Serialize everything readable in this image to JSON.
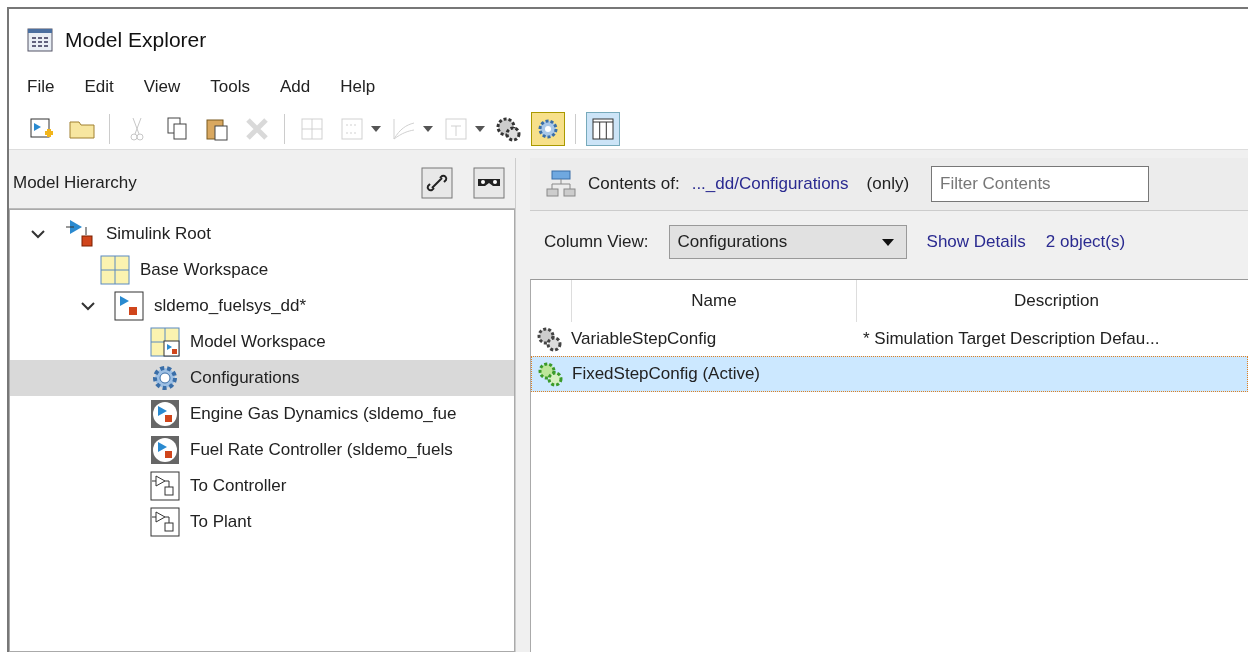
{
  "window": {
    "title": "Model Explorer"
  },
  "menu": [
    "File",
    "Edit",
    "View",
    "Tools",
    "Add",
    "Help"
  ],
  "toolbar": [
    {
      "kind": "new-model",
      "disabled": false,
      "on": false
    },
    {
      "kind": "open",
      "disabled": false,
      "on": false
    },
    {
      "kind": "separator"
    },
    {
      "kind": "cut",
      "disabled": true,
      "on": false
    },
    {
      "kind": "copy",
      "disabled": false,
      "on": false
    },
    {
      "kind": "paste",
      "disabled": false,
      "on": false
    },
    {
      "kind": "delete",
      "disabled": true,
      "on": false
    },
    {
      "kind": "separator"
    },
    {
      "kind": "grid",
      "disabled": true,
      "on": false
    },
    {
      "kind": "binary",
      "disabled": true,
      "on": false
    },
    {
      "kind": "caret"
    },
    {
      "kind": "lines",
      "disabled": true,
      "on": false
    },
    {
      "kind": "caret"
    },
    {
      "kind": "box",
      "disabled": true,
      "on": false
    },
    {
      "kind": "caret"
    },
    {
      "kind": "gears",
      "disabled": false,
      "on": false
    },
    {
      "kind": "config",
      "disabled": false,
      "on": true
    },
    {
      "kind": "separator"
    },
    {
      "kind": "columns",
      "disabled": false,
      "on": true
    }
  ],
  "hierarchy": {
    "title": "Model Hierarchy",
    "tree": [
      {
        "label": "Simulink Root",
        "kind": "root",
        "selected": false,
        "expanded": true,
        "children": [
          {
            "label": "Base Workspace",
            "kind": "workspace",
            "selected": false
          },
          {
            "label": "sldemo_fuelsys_dd*",
            "kind": "model",
            "selected": false,
            "expanded": true,
            "children": [
              {
                "label": "Model Workspace",
                "kind": "model-workspace",
                "selected": false
              },
              {
                "label": "Configurations",
                "kind": "config",
                "selected": true
              },
              {
                "label": "Engine Gas Dynamics (sldemo_fue",
                "kind": "model-ref",
                "selected": false
              },
              {
                "label": "Fuel Rate Controller (sldemo_fuels",
                "kind": "model-ref",
                "selected": false
              },
              {
                "label": "To Controller",
                "kind": "subsystem",
                "selected": false
              },
              {
                "label": "To Plant",
                "kind": "subsystem",
                "selected": false
              }
            ]
          }
        ]
      }
    ]
  },
  "contents": {
    "label": "Contents of:",
    "path": "..._dd/Configurations",
    "scope": "(only)",
    "filter": {
      "placeholder": "Filter Contents"
    },
    "column_view_label": "Column View:",
    "column_view": "Configurations",
    "show_details": "Show Details",
    "count": "2 object(s)",
    "table": {
      "columns": [
        "Name",
        "Description"
      ],
      "rows": [
        {
          "name": "VariableStepConfig",
          "description": "* Simulation Target Description Defau...",
          "active": false,
          "selected": false
        },
        {
          "name": "FixedStepConfig (Active)",
          "description": "",
          "active": true,
          "selected": true
        }
      ]
    }
  }
}
